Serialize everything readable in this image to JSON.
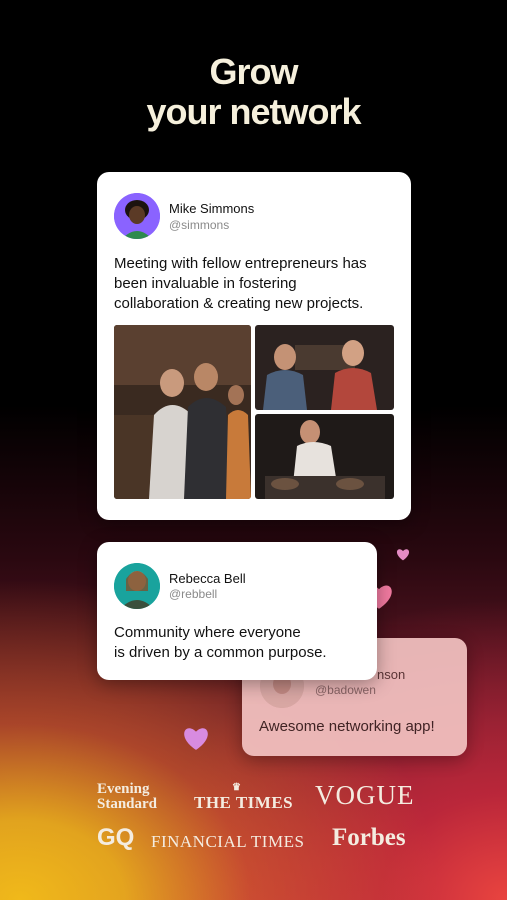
{
  "headline": {
    "line1": "Grow",
    "line2": "your network"
  },
  "main_post": {
    "author": "Mike Simmons",
    "handle": "@simmons",
    "text_lines": [
      "Meeting with fellow entrepreneurs has",
      "been invaluable in fostering",
      "collaboration & creating new projects."
    ]
  },
  "rebecca_post": {
    "author": "Rebecca Bell",
    "handle": "@rebbell",
    "text_lines": [
      "Community where everyone",
      "is driven by a common purpose."
    ]
  },
  "owen_post": {
    "author_partial": "nson",
    "handle": "@badowen",
    "text": "Awesome networking app!"
  },
  "press_logos": {
    "evening_standard": [
      "Evening",
      "Standard"
    ],
    "the_times": "THE TIMES",
    "vogue": "VOGUE",
    "gq": "GQ",
    "financial_times": "FINANCIAL TIMES",
    "forbes": "Forbes"
  },
  "colors": {
    "headline": "#f6f0dc",
    "heart": "#f07aa0",
    "card_bg": "#ffffff"
  },
  "icons": [
    "heart-icon"
  ]
}
